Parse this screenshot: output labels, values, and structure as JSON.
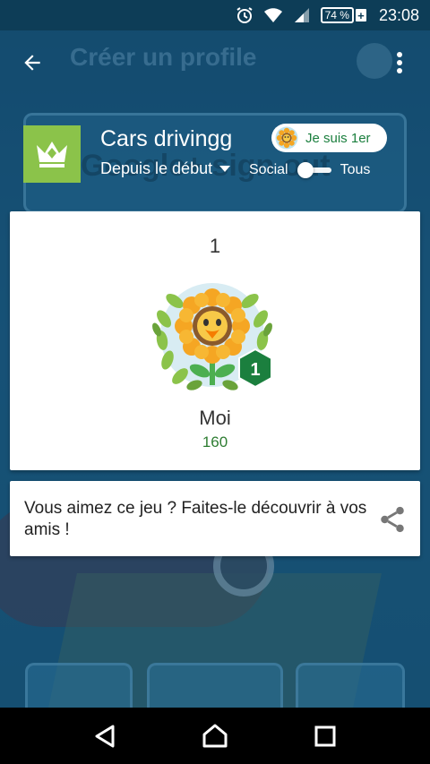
{
  "status_bar": {
    "icons": [
      "alarm-icon",
      "wifi-icon",
      "signal-icon"
    ],
    "battery": "74 %",
    "time": "23:08"
  },
  "app_bar": {
    "background_title": "Créer un profile",
    "back_icon": "arrow-back-icon",
    "menu_icon": "more-vert-icon"
  },
  "header": {
    "background_text": "Google+ sign out",
    "game_title": "Cars drivingg",
    "period_selector": "Depuis le début",
    "badge_label": "Je suis 1er",
    "toggle_left_label": "Social",
    "toggle_right_label": "Tous",
    "toggle_position": "left"
  },
  "player_card": {
    "rank": "1",
    "rank_badge": "1",
    "name": "Moi",
    "score": "160"
  },
  "share_card": {
    "text": "Vous aimez ce jeu ? Faites-le découvrir à vos amis !",
    "icon": "share-icon"
  },
  "nav_bar": {
    "icons": [
      "back-triangle-icon",
      "home-circle-icon",
      "recents-square-icon"
    ]
  },
  "colors": {
    "accent_green": "#8bc34a",
    "score_green": "#2e7d32",
    "badge_green": "#1b7f3e",
    "background_blue": "#1d5a7d"
  }
}
